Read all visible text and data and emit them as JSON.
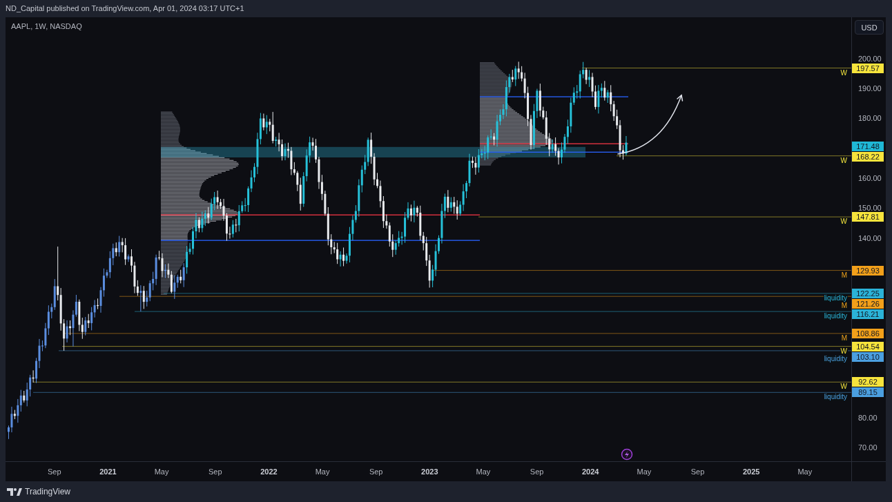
{
  "header": {
    "caption": "ND_Capital published on TradingView.com, Apr 01, 2024 03:17 UTC+1"
  },
  "chart": {
    "symbol": "AAPL, 1W, NASDAQ",
    "currency": "USD",
    "price_ticks": [
      "200.00",
      "190.00",
      "180.00",
      "160.00",
      "150.00",
      "140.00",
      "80.00",
      "70.00"
    ],
    "levels": [
      {
        "kind": "level",
        "price": "197.57",
        "note": "W",
        "color": "#f7e43c"
      },
      {
        "kind": "last",
        "price": "171.48",
        "color": "#1fb8d6"
      },
      {
        "kind": "level",
        "price": "168.22",
        "note": "W",
        "color": "#f7e43c"
      },
      {
        "kind": "level",
        "price": "147.81",
        "note": "W",
        "color": "#f7e43c"
      },
      {
        "kind": "level",
        "price": "129.93",
        "note": "M",
        "color": "#f2a01a"
      },
      {
        "kind": "level",
        "price": "122.25",
        "note": "liquidity",
        "color": "#2bb3d8"
      },
      {
        "kind": "level",
        "price": "121.26",
        "note": "M",
        "color": "#f2a01a"
      },
      {
        "kind": "level",
        "price": "116.21",
        "note": "liquidity",
        "color": "#2bb3d8"
      },
      {
        "kind": "level",
        "price": "108.86",
        "note": "M",
        "color": "#f2a01a"
      },
      {
        "kind": "level",
        "price": "104.54",
        "note": "W",
        "color": "#f7e43c"
      },
      {
        "kind": "level",
        "price": "103.10",
        "note": "liquidity",
        "color": "#4b9fe0"
      },
      {
        "kind": "level",
        "price": "92.62",
        "note": "W",
        "color": "#f7e43c"
      },
      {
        "kind": "level",
        "price": "89.15",
        "note": "liquidity",
        "color": "#4b9fe0"
      }
    ],
    "time_ticks": [
      {
        "label": "Sep",
        "kind": "month"
      },
      {
        "label": "2021",
        "kind": "year"
      },
      {
        "label": "May",
        "kind": "month"
      },
      {
        "label": "Sep",
        "kind": "month"
      },
      {
        "label": "2022",
        "kind": "year"
      },
      {
        "label": "May",
        "kind": "month"
      },
      {
        "label": "Sep",
        "kind": "month"
      },
      {
        "label": "2023",
        "kind": "year"
      },
      {
        "label": "May",
        "kind": "month"
      },
      {
        "label": "Sep",
        "kind": "month"
      },
      {
        "label": "2024",
        "kind": "year"
      },
      {
        "label": "May",
        "kind": "month"
      },
      {
        "label": "Sep",
        "kind": "month"
      },
      {
        "label": "2025",
        "kind": "year"
      },
      {
        "label": "May",
        "kind": "month"
      }
    ]
  },
  "footer": {
    "brand": "TradingView"
  }
}
